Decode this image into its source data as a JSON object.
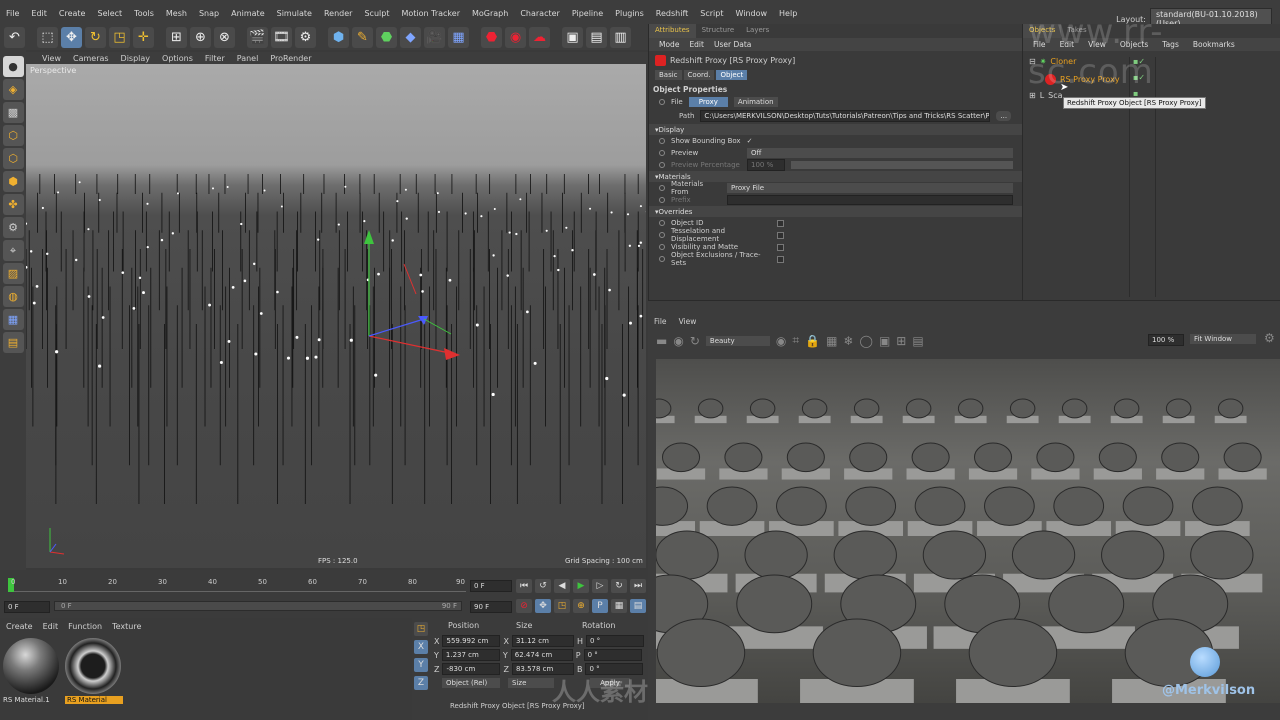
{
  "menubar": {
    "items": [
      "File",
      "Edit",
      "Create",
      "Select",
      "Tools",
      "Mesh",
      "Snap",
      "Animate",
      "Simulate",
      "Render",
      "Sculpt",
      "Motion Tracker",
      "MoGraph",
      "Character",
      "Pipeline",
      "Plugins",
      "Redshift",
      "Script",
      "Window",
      "Help"
    ],
    "layout_label": "Layout:",
    "layout_value": "standard(BU-01.10.2018) (User)"
  },
  "viewport": {
    "menu": [
      "View",
      "Cameras",
      "Display",
      "Options",
      "Filter",
      "Panel",
      "ProRender"
    ],
    "label": "Perspective",
    "fps": "FPS : 125.0",
    "grid_spacing": "Grid Spacing : 100 cm"
  },
  "timeline": {
    "ticks": [
      "0",
      "10",
      "20",
      "30",
      "40",
      "50",
      "60",
      "70",
      "80",
      "90"
    ],
    "current_frame": "0 F",
    "start_field": "0 F",
    "end_field": "90 F",
    "range_start": "0 F",
    "range_end": "90 F"
  },
  "materials": {
    "menu": [
      "Create",
      "Edit",
      "Function",
      "Texture"
    ],
    "items": [
      {
        "name": "RS Material.1"
      },
      {
        "name": "RS Material"
      }
    ]
  },
  "coords": {
    "headers": [
      "Position",
      "Size",
      "Rotation"
    ],
    "rows": [
      {
        "axis": "X",
        "pos": "559.992 cm",
        "size_axis": "X",
        "size": "31.12 cm",
        "rot_axis": "H",
        "rot": "0 °"
      },
      {
        "axis": "Y",
        "pos": "1.237 cm",
        "size_axis": "Y",
        "size": "62.474 cm",
        "rot_axis": "P",
        "rot": "0 °"
      },
      {
        "axis": "Z",
        "pos": "-830 cm",
        "size_axis": "Z",
        "size": "83.578 cm",
        "rot_axis": "B",
        "rot": "0 °"
      }
    ],
    "mode_object": "Object (Rel)",
    "mode_size": "Size",
    "apply": "Apply",
    "status": "Redshift Proxy Object [RS Proxy Proxy]"
  },
  "attributes": {
    "tabs": [
      "Attributes",
      "Structure",
      "Layers"
    ],
    "menu": [
      "Mode",
      "Edit",
      "User Data"
    ],
    "object_title": "Redshift Proxy [RS Proxy Proxy]",
    "subtabs": [
      "Basic",
      "Coord.",
      "Object"
    ],
    "section_props": "Object Properties",
    "file_label": "File",
    "file_tabs": [
      "Proxy",
      "Animation"
    ],
    "path_label": "Path",
    "path_value": "C:\\Users\\MERKVILSON\\Desktop\\Tuts\\Tutorials\\Patreon\\Tips and Tricks\\RS Scatter\\Pro",
    "path_button": "...",
    "display_section": "Display",
    "show_bbox": "Show Bounding Box",
    "show_bbox_check": "✓",
    "preview": "Preview",
    "preview_value": "Off",
    "preview_pct": "Preview Percentage",
    "preview_pct_value": "100 %",
    "materials_section": "Materials",
    "materials_from": "Materials From",
    "materials_from_value": "Proxy File",
    "prefix": "Prefix",
    "overrides_section": "Overrides",
    "overrides": [
      "Object ID",
      "Tesselation and Displacement",
      "Visibility and Matte",
      "Object Exclusions / Trace-Sets"
    ]
  },
  "objects": {
    "tabs": [
      "Objects",
      "Takes"
    ],
    "menu": [
      "File",
      "Edit",
      "View",
      "Objects",
      "Tags",
      "Bookmarks"
    ],
    "tree": [
      {
        "name": "Cloner"
      },
      {
        "name": "RS Proxy Proxy"
      },
      {
        "name": "Sca"
      }
    ],
    "tooltip": "Redshift Proxy Object [RS Proxy Proxy]"
  },
  "render_view": {
    "menu": [
      "File",
      "View"
    ],
    "aov": "Beauty",
    "zoom": "100 %",
    "fit": "Fit Window"
  },
  "watermarks": {
    "site": "www.rr-sc.com",
    "author": "@Merkvilson",
    "cn": "人人素材"
  }
}
